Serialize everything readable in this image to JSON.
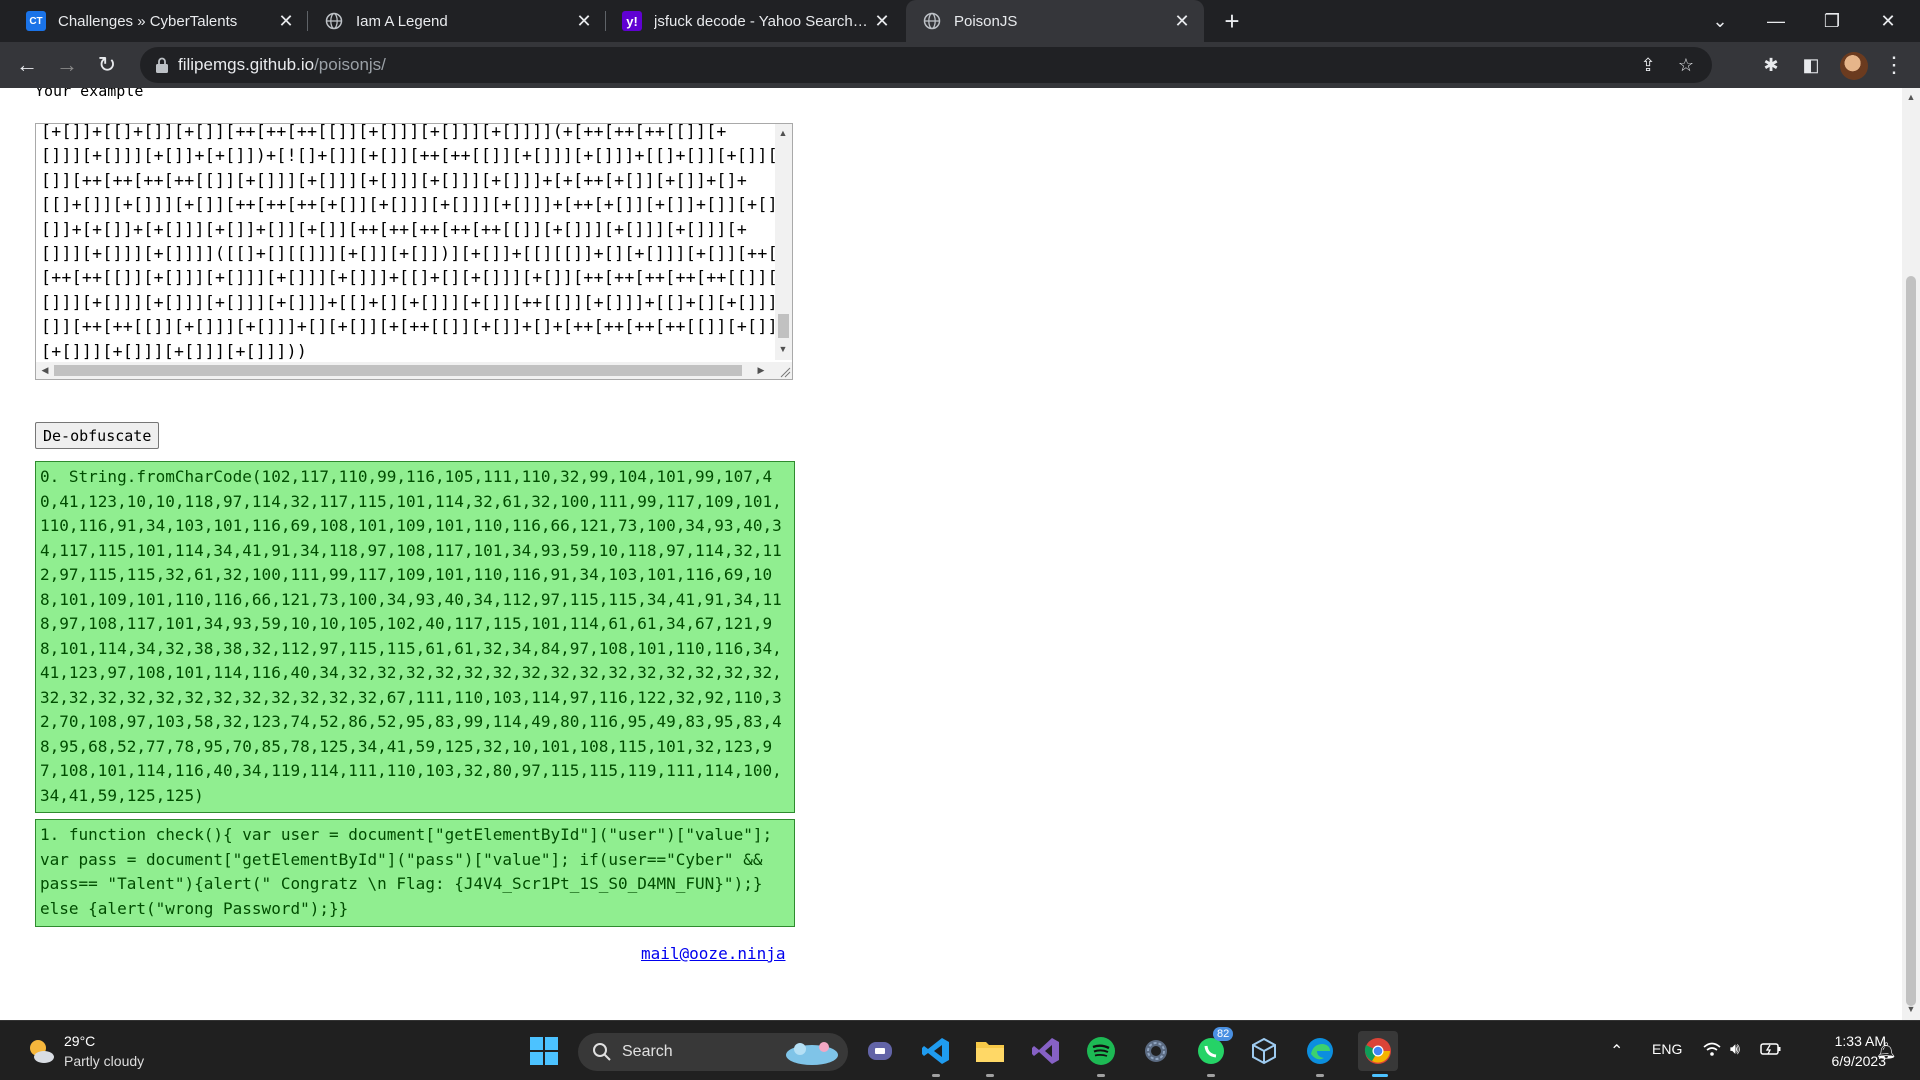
{
  "browser": {
    "tabs": [
      {
        "title": "Challenges » CyberTalents",
        "favicon": "cybertalents-icon"
      },
      {
        "title": "Iam A Legend",
        "favicon": "globe-icon"
      },
      {
        "title": "jsfuck decode - Yahoo Search Re",
        "favicon": "yahoo-icon"
      },
      {
        "title": "PoisonJS",
        "favicon": "globe-icon",
        "active": true
      }
    ],
    "address": {
      "host": "filipemgs.github.io",
      "path": "/poisonjs/"
    }
  },
  "page": {
    "example_label": "Your example",
    "code_lines": [
      "[+[]]+[[]+[]][+[]][++[++[++[[]][+[]]][+[]]][+[]]]](+[++[++[++[[]][+",
      "[]]][+[]]][+[]]+[+[]])+[![]+[]][+[]][++[++[[]][+[]]][+[]]]+[[]+[]][+[]][+",
      "[]][++[++[++[++[[]][+[]]][+[]]][+[]]][+[]]][+[]]]+[+[++[+[]][+[]]+[]+",
      "[[]+[]][+[]]][+[]][++[++[++[+[]][+[]]][+[]]][+[]]]+[++[+[]][+[]]+[]][+[]]+[+",
      "[]]+[+[]]+[+[]]][+[]]+[]][+[]][++[++[++[++[++[[]][+[]]][+[]]][+[]]][+",
      "[]]][+[]]][+[]]]]([[]+[][[]]][+[]][+[]])][+[]]+[[][[]]+[][+[]]][+[]][++[++",
      "[++[++[[]][+[]]][+[]]][+[]]][+[]]]+[[]+[][+[]]][+[]][++[++[++[++[++[[]][+",
      "[]]][+[]]][+[]]][+[]]][+[]]]+[[]+[][+[]]][+[]][++[[]][+[]]]+[[]+[][+[]]][+",
      "[]][++[++[[]][+[]]][+[]]]+[][+[]][+[++[[]][+[]]+[]+[++[++[++[++[[]][+[]]]",
      "[+[]]][+[]]][+[]]][+[]]]))"
    ],
    "deobfuscate_label": "De-obfuscate",
    "result0": "0. String.fromCharCode(102,117,110,99,116,105,111,110,32,99,104,101,99,107,40,41,123,10,10,118,97,114,32,117,115,101,114,32,61,32,100,111,99,117,109,101,110,116,91,34,103,101,116,69,108,101,109,101,110,116,66,121,73,100,34,93,40,34,117,115,101,114,34,41,91,34,118,97,108,117,101,34,93,59,10,118,97,114,32,112,97,115,115,32,61,32,100,111,99,117,109,101,110,116,91,34,103,101,116,69,108,101,109,101,110,116,66,121,73,100,34,93,40,34,112,97,115,115,34,41,91,34,118,97,108,117,101,34,93,59,10,10,105,102,40,117,115,101,114,61,61,34,67,121,98,101,114,34,32,38,38,32,112,97,115,115,61,61,32,34,84,97,108,101,110,116,34,41,123,97,108,101,114,116,40,34,32,32,32,32,32,32,32,32,32,32,32,32,32,32,32,32,32,32,32,32,32,32,32,32,32,32,32,67,111,110,103,114,97,116,122,32,92,110,32,70,108,97,103,58,32,123,74,52,86,52,95,83,99,114,49,80,116,95,49,83,95,83,48,95,68,52,77,78,95,70,85,78,125,34,41,59,125,32,10,101,108,115,101,32,123,97,108,101,114,116,40,34,119,114,111,110,103,32,80,97,115,115,119,111,114,100,34,41,59,125,125)",
    "result1": "1. function check(){ var user = document[\"getElementById\"](\"user\")[\"value\"]; var pass = document[\"getElementById\"](\"pass\")[\"value\"]; if(user==\"Cyber\" && pass== \"Talent\"){alert(\" Congratz \\n Flag: {J4V4_Scr1Pt_1S_S0_D4MN_FUN}\");} else {alert(\"wrong Password\");}}",
    "contact": "mail@ooze.ninja"
  },
  "taskbar": {
    "weather": {
      "temp": "29°C",
      "desc": "Partly cloudy"
    },
    "search_label": "Search",
    "whatsapp_badge": "82",
    "language": "ENG",
    "time": "1:33 AM",
    "date": "6/9/2023"
  }
}
